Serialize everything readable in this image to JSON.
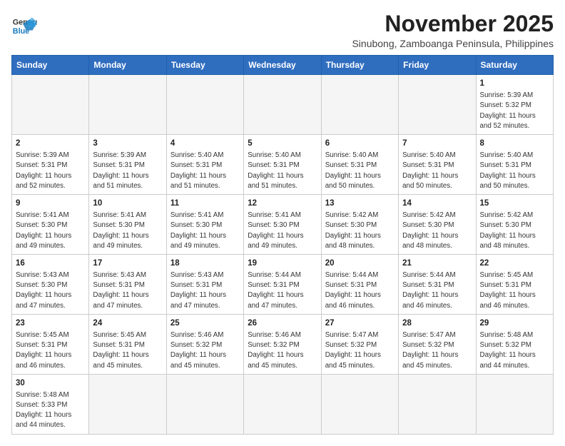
{
  "logo": {
    "line1": "General",
    "line2": "Blue"
  },
  "title": "November 2025",
  "subtitle": "Sinubong, Zamboanga Peninsula, Philippines",
  "days_of_week": [
    "Sunday",
    "Monday",
    "Tuesday",
    "Wednesday",
    "Thursday",
    "Friday",
    "Saturday"
  ],
  "weeks": [
    [
      {
        "day": "",
        "info": ""
      },
      {
        "day": "",
        "info": ""
      },
      {
        "day": "",
        "info": ""
      },
      {
        "day": "",
        "info": ""
      },
      {
        "day": "",
        "info": ""
      },
      {
        "day": "",
        "info": ""
      },
      {
        "day": "1",
        "info": "Sunrise: 5:39 AM\nSunset: 5:32 PM\nDaylight: 11 hours\nand 52 minutes."
      }
    ],
    [
      {
        "day": "2",
        "info": "Sunrise: 5:39 AM\nSunset: 5:31 PM\nDaylight: 11 hours\nand 52 minutes."
      },
      {
        "day": "3",
        "info": "Sunrise: 5:39 AM\nSunset: 5:31 PM\nDaylight: 11 hours\nand 51 minutes."
      },
      {
        "day": "4",
        "info": "Sunrise: 5:40 AM\nSunset: 5:31 PM\nDaylight: 11 hours\nand 51 minutes."
      },
      {
        "day": "5",
        "info": "Sunrise: 5:40 AM\nSunset: 5:31 PM\nDaylight: 11 hours\nand 51 minutes."
      },
      {
        "day": "6",
        "info": "Sunrise: 5:40 AM\nSunset: 5:31 PM\nDaylight: 11 hours\nand 50 minutes."
      },
      {
        "day": "7",
        "info": "Sunrise: 5:40 AM\nSunset: 5:31 PM\nDaylight: 11 hours\nand 50 minutes."
      },
      {
        "day": "8",
        "info": "Sunrise: 5:40 AM\nSunset: 5:31 PM\nDaylight: 11 hours\nand 50 minutes."
      }
    ],
    [
      {
        "day": "9",
        "info": "Sunrise: 5:41 AM\nSunset: 5:30 PM\nDaylight: 11 hours\nand 49 minutes."
      },
      {
        "day": "10",
        "info": "Sunrise: 5:41 AM\nSunset: 5:30 PM\nDaylight: 11 hours\nand 49 minutes."
      },
      {
        "day": "11",
        "info": "Sunrise: 5:41 AM\nSunset: 5:30 PM\nDaylight: 11 hours\nand 49 minutes."
      },
      {
        "day": "12",
        "info": "Sunrise: 5:41 AM\nSunset: 5:30 PM\nDaylight: 11 hours\nand 49 minutes."
      },
      {
        "day": "13",
        "info": "Sunrise: 5:42 AM\nSunset: 5:30 PM\nDaylight: 11 hours\nand 48 minutes."
      },
      {
        "day": "14",
        "info": "Sunrise: 5:42 AM\nSunset: 5:30 PM\nDaylight: 11 hours\nand 48 minutes."
      },
      {
        "day": "15",
        "info": "Sunrise: 5:42 AM\nSunset: 5:30 PM\nDaylight: 11 hours\nand 48 minutes."
      }
    ],
    [
      {
        "day": "16",
        "info": "Sunrise: 5:43 AM\nSunset: 5:30 PM\nDaylight: 11 hours\nand 47 minutes."
      },
      {
        "day": "17",
        "info": "Sunrise: 5:43 AM\nSunset: 5:31 PM\nDaylight: 11 hours\nand 47 minutes."
      },
      {
        "day": "18",
        "info": "Sunrise: 5:43 AM\nSunset: 5:31 PM\nDaylight: 11 hours\nand 47 minutes."
      },
      {
        "day": "19",
        "info": "Sunrise: 5:44 AM\nSunset: 5:31 PM\nDaylight: 11 hours\nand 47 minutes."
      },
      {
        "day": "20",
        "info": "Sunrise: 5:44 AM\nSunset: 5:31 PM\nDaylight: 11 hours\nand 46 minutes."
      },
      {
        "day": "21",
        "info": "Sunrise: 5:44 AM\nSunset: 5:31 PM\nDaylight: 11 hours\nand 46 minutes."
      },
      {
        "day": "22",
        "info": "Sunrise: 5:45 AM\nSunset: 5:31 PM\nDaylight: 11 hours\nand 46 minutes."
      }
    ],
    [
      {
        "day": "23",
        "info": "Sunrise: 5:45 AM\nSunset: 5:31 PM\nDaylight: 11 hours\nand 46 minutes."
      },
      {
        "day": "24",
        "info": "Sunrise: 5:45 AM\nSunset: 5:31 PM\nDaylight: 11 hours\nand 45 minutes."
      },
      {
        "day": "25",
        "info": "Sunrise: 5:46 AM\nSunset: 5:32 PM\nDaylight: 11 hours\nand 45 minutes."
      },
      {
        "day": "26",
        "info": "Sunrise: 5:46 AM\nSunset: 5:32 PM\nDaylight: 11 hours\nand 45 minutes."
      },
      {
        "day": "27",
        "info": "Sunrise: 5:47 AM\nSunset: 5:32 PM\nDaylight: 11 hours\nand 45 minutes."
      },
      {
        "day": "28",
        "info": "Sunrise: 5:47 AM\nSunset: 5:32 PM\nDaylight: 11 hours\nand 45 minutes."
      },
      {
        "day": "29",
        "info": "Sunrise: 5:48 AM\nSunset: 5:32 PM\nDaylight: 11 hours\nand 44 minutes."
      }
    ],
    [
      {
        "day": "30",
        "info": "Sunrise: 5:48 AM\nSunset: 5:33 PM\nDaylight: 11 hours\nand 44 minutes."
      },
      {
        "day": "",
        "info": ""
      },
      {
        "day": "",
        "info": ""
      },
      {
        "day": "",
        "info": ""
      },
      {
        "day": "",
        "info": ""
      },
      {
        "day": "",
        "info": ""
      },
      {
        "day": "",
        "info": ""
      }
    ]
  ]
}
